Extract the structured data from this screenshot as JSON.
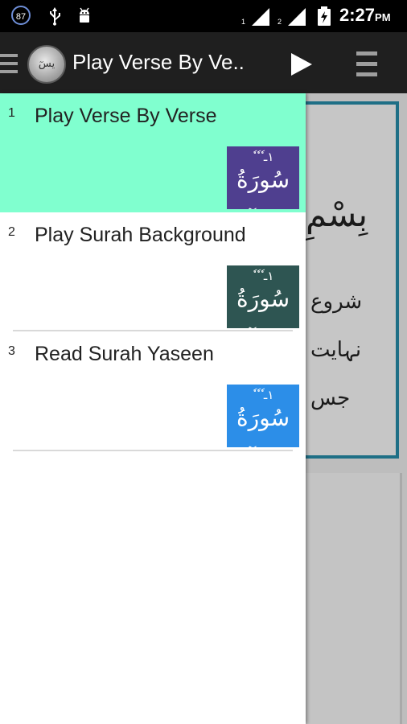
{
  "status_bar": {
    "notification_count": "87",
    "icons": [
      "usb-icon",
      "android-debug-icon",
      "signal-1-icon",
      "signal-2-icon",
      "battery-charging-icon"
    ],
    "sim1_label": "1",
    "sim2_label": "2",
    "time": "2:27",
    "ampm": "PM"
  },
  "action_bar": {
    "logo_text": "يسٓ",
    "title": "Play Verse By Ve..",
    "actions": [
      "drawer-menu-icon",
      "play-icon",
      "overflow-menu-icon"
    ]
  },
  "drawer": {
    "items": [
      {
        "number": "1",
        "label": "Play Verse By Verse",
        "thumb_text": "سُورَةُ يسٓ",
        "thumb_color": "#4f3f8f",
        "selected": true
      },
      {
        "number": "2",
        "label": "Play Surah Background",
        "thumb_text": "سُورَةُ يسٓ",
        "thumb_color": "#2e5552",
        "selected": false
      },
      {
        "number": "3",
        "label": "Read Surah Yaseen",
        "thumb_text": "سُورَةُ يسٓ",
        "thumb_color": "#2c8ee8",
        "selected": false
      }
    ],
    "selected_bg": "#80ffcf"
  },
  "background_content": {
    "line1": "بِسْمِ",
    "line2": "شروع",
    "line3": "نہایت",
    "line4": "جس"
  },
  "colors": {
    "status_bar": "#000000",
    "action_bar": "#1f1f1f",
    "card_border": "#1e6f86"
  }
}
